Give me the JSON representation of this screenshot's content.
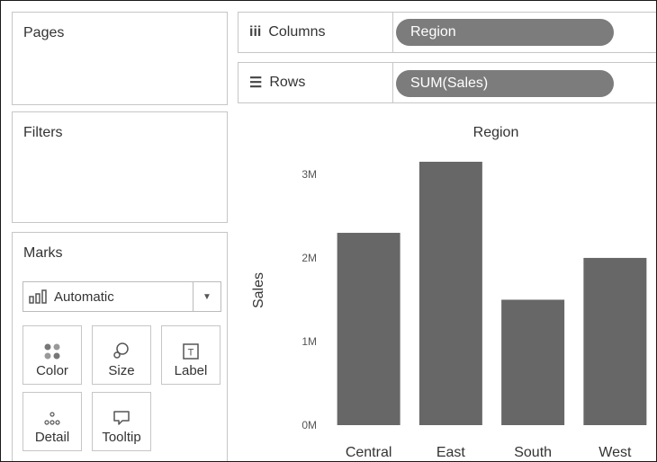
{
  "panels": {
    "pages_title": "Pages",
    "filters_title": "Filters",
    "marks_title": "Marks"
  },
  "shelves": {
    "columns": {
      "label": "Columns",
      "icon": "columns-icon",
      "pill": "Region"
    },
    "rows": {
      "label": "Rows",
      "icon": "rows-icon",
      "pill": "SUM(Sales)"
    }
  },
  "marks": {
    "mark_type": "Automatic",
    "buttons": [
      {
        "label": "Color",
        "icon": "color-icon"
      },
      {
        "label": "Size",
        "icon": "size-icon"
      },
      {
        "label": "Label",
        "icon": "label-icon"
      },
      {
        "label": "Detail",
        "icon": "detail-icon"
      },
      {
        "label": "Tooltip",
        "icon": "tooltip-icon"
      }
    ]
  },
  "colors": {
    "bar": "#676767",
    "pill": "#7c7c7c",
    "border": "#c6c6c6"
  },
  "chart_data": {
    "type": "bar",
    "title": "Region",
    "xlabel": "",
    "ylabel": "Sales",
    "categories": [
      "Central",
      "East",
      "South",
      "West"
    ],
    "values": [
      2300000,
      3150000,
      1500000,
      2000000
    ],
    "ylim": [
      0,
      3300000
    ],
    "yticks": [
      0,
      1000000,
      2000000,
      3000000
    ],
    "ytick_labels": [
      "0M",
      "1M",
      "2M",
      "3M"
    ],
    "grid": false
  }
}
